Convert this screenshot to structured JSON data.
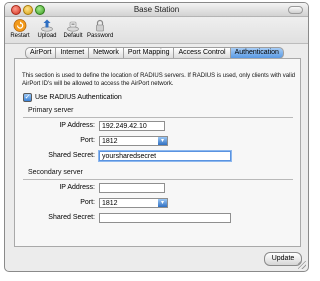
{
  "window": {
    "title": "Base Station"
  },
  "toolbar": {
    "items": [
      {
        "label": "Restart",
        "icon": "restart-icon"
      },
      {
        "label": "Upload",
        "icon": "upload-icon"
      },
      {
        "label": "Default",
        "icon": "default-icon"
      },
      {
        "label": "Password",
        "icon": "password-lock-icon"
      }
    ]
  },
  "tabs": [
    {
      "label": "AirPort",
      "active": false
    },
    {
      "label": "Internet",
      "active": false
    },
    {
      "label": "Network",
      "active": false
    },
    {
      "label": "Port Mapping",
      "active": false
    },
    {
      "label": "Access Control",
      "active": false
    },
    {
      "label": "Authentication",
      "active": true
    }
  ],
  "panel": {
    "description": "This section is used to define the location of RADIUS servers. If RADIUS is used, only clients with valid AirPort ID's will be allowed to access the AirPort network.",
    "use_radius": {
      "label": "Use RADIUS Authentication",
      "checked": true
    },
    "primary": {
      "heading": "Primary server",
      "ip_label": "IP Address:",
      "ip_value": "192.249.42.10",
      "port_label": "Port:",
      "port_value": "1812",
      "secret_label": "Shared Secret:",
      "secret_value": "yoursharedsecret"
    },
    "secondary": {
      "heading": "Secondary server",
      "ip_label": "IP Address:",
      "ip_value": "",
      "port_label": "Port:",
      "port_value": "1812",
      "secret_label": "Shared Secret:",
      "secret_value": ""
    }
  },
  "buttons": {
    "update": "Update"
  },
  "colors": {
    "accent": "#5a9ae3",
    "window_bg": "#ececec",
    "panel_bg": "#f7f7f7"
  }
}
